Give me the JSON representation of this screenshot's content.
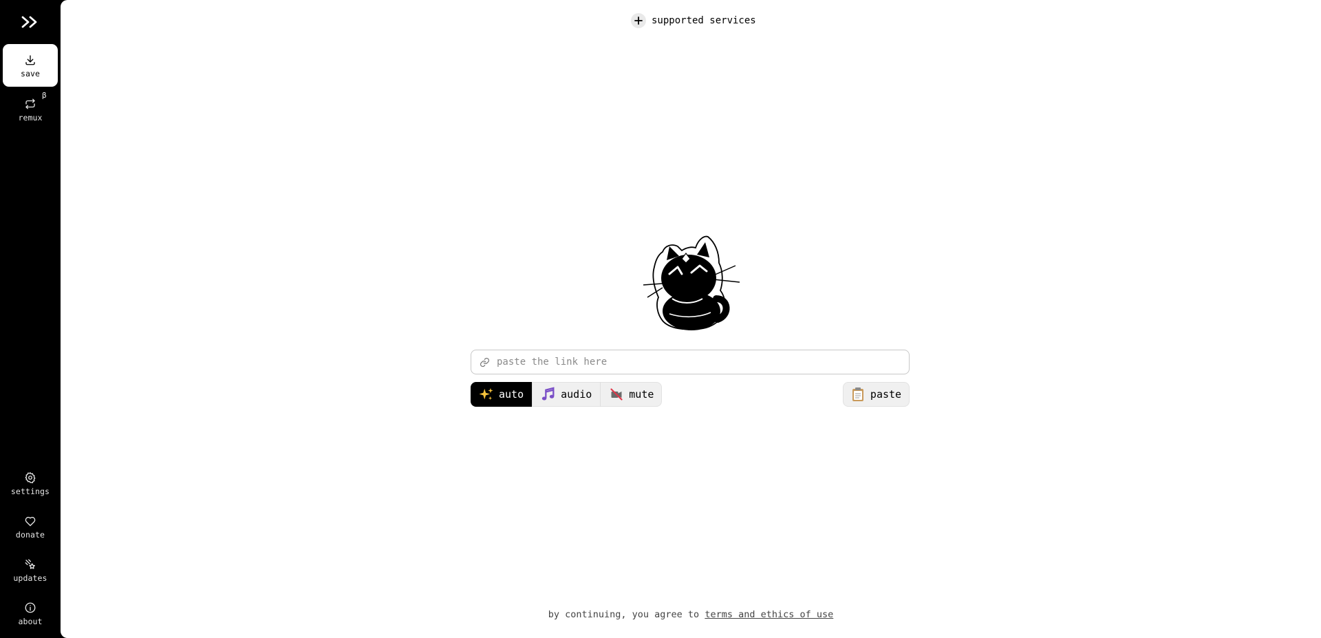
{
  "sidebar": {
    "logo_text": ">>",
    "items": [
      {
        "name": "save",
        "label": "save",
        "icon": "download-icon",
        "active": true
      },
      {
        "name": "remux",
        "label": "remux",
        "icon": "repeat-icon",
        "badge": "β"
      },
      {
        "name": "settings",
        "label": "settings",
        "icon": "gear-icon"
      },
      {
        "name": "donate",
        "label": "donate",
        "icon": "heart-icon"
      },
      {
        "name": "updates",
        "label": "updates",
        "icon": "comet-icon"
      },
      {
        "name": "about",
        "label": "about",
        "icon": "info-icon"
      }
    ]
  },
  "header": {
    "services_label": "supported services",
    "services_icon": "plus-icon"
  },
  "mascot": {
    "icon": "cat-mascot-icon"
  },
  "input": {
    "placeholder": "paste the link here",
    "value": "",
    "icon": "link-icon"
  },
  "modes": [
    {
      "label": "auto",
      "icon": "sparkles-icon",
      "active": true
    },
    {
      "label": "audio",
      "icon": "music-notes-icon",
      "active": false
    },
    {
      "label": "mute",
      "icon": "muted-camera-icon",
      "active": false
    }
  ],
  "paste": {
    "label": "paste",
    "icon": "clipboard-icon"
  },
  "footer": {
    "text": "by continuing, you agree to",
    "link_text": "terms and ethics of use"
  },
  "colors": {
    "sidebar_bg": "#000000",
    "main_bg": "#ffffff",
    "active_bg": "#ffffff",
    "button_bg": "#f0f0f0"
  }
}
